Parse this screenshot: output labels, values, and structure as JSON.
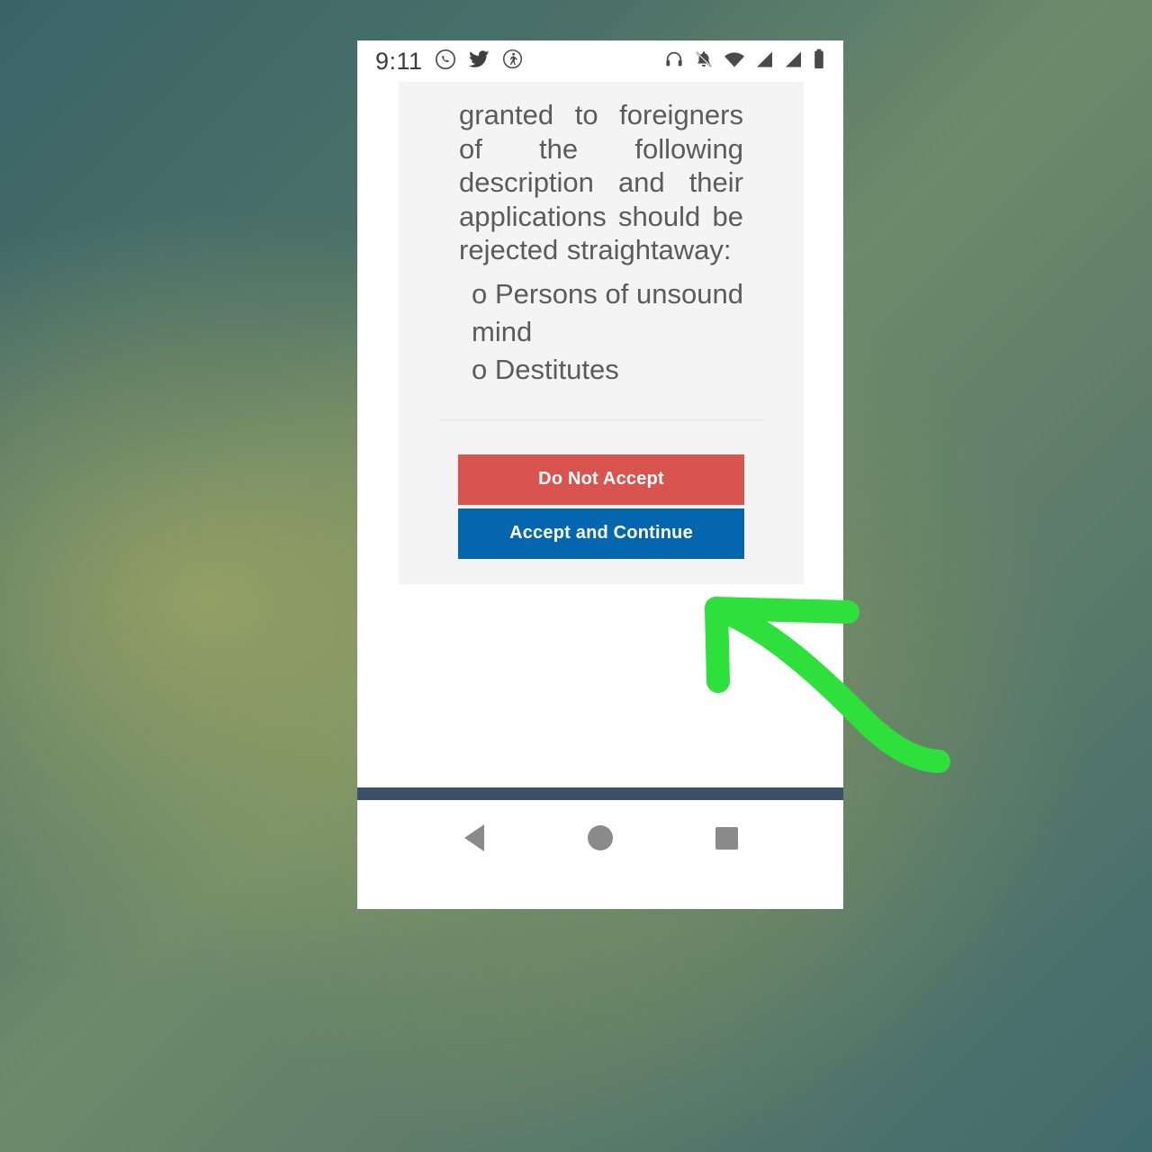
{
  "background": {
    "gradient_from": "#3a6468",
    "gradient_mid": "#8a9a6b",
    "gradient_to": "#3f6a6d"
  },
  "status_bar": {
    "time": "9:11",
    "left_icons": [
      {
        "name": "whatsapp-icon",
        "glyph": "whatsapp"
      },
      {
        "name": "twitter-icon",
        "glyph": "twitter"
      },
      {
        "name": "fitness-walking-icon",
        "glyph": "walk"
      }
    ],
    "right_icons": [
      {
        "name": "headset-icon",
        "glyph": "headset"
      },
      {
        "name": "notifications-muted-icon",
        "glyph": "bell-slash"
      },
      {
        "name": "wifi-icon",
        "glyph": "wifi"
      },
      {
        "name": "cellular-signal-1-icon",
        "glyph": "signal"
      },
      {
        "name": "cellular-signal-2-icon",
        "glyph": "signal"
      },
      {
        "name": "battery-icon",
        "glyph": "battery"
      }
    ]
  },
  "content": {
    "paragraph": "granted to foreigners of the following description and their applications should be rejected straightaway:",
    "bullets": [
      {
        "marker": "o",
        "text": "Persons of unsound mind"
      },
      {
        "marker": "o",
        "text": "Destitutes"
      }
    ]
  },
  "buttons": {
    "deny": {
      "label": "Do Not Accept",
      "color": "#d9534f"
    },
    "accept": {
      "label": "Accept and Continue",
      "color": "#0566b0"
    }
  },
  "navigation_bar": {
    "back_label": "Back",
    "home_label": "Home",
    "recents_label": "Recents",
    "accent_color": "#3a5069"
  },
  "annotation": {
    "arrow_color": "#2de03c",
    "points_to": "Accept and Continue"
  }
}
